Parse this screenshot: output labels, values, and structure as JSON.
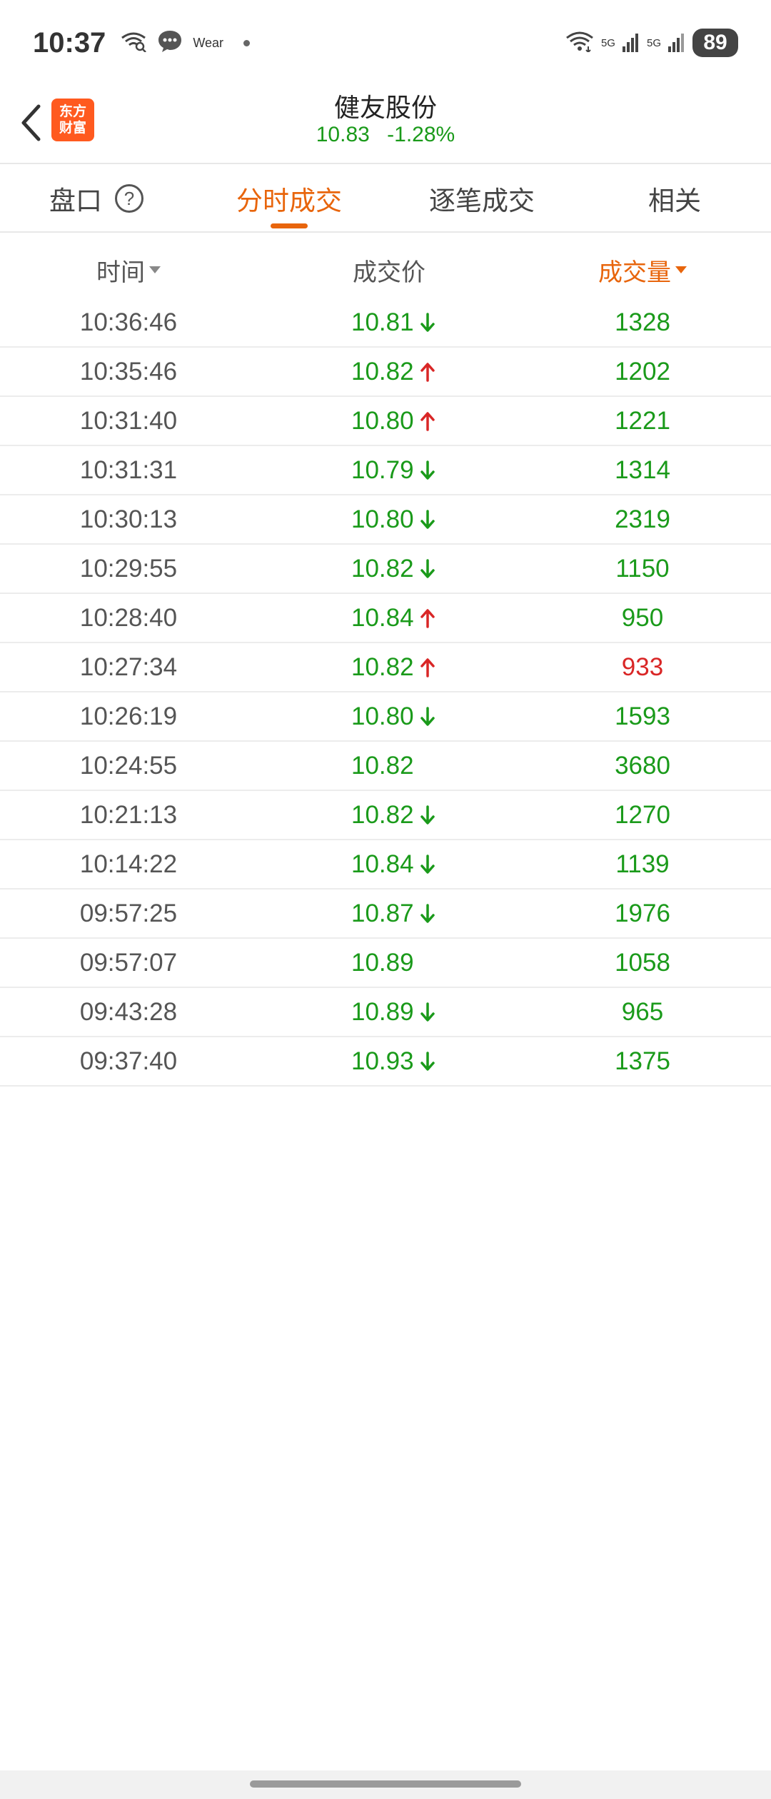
{
  "status_bar": {
    "time": "10:37",
    "wear": "Wear",
    "net1": "5G",
    "net2": "5G",
    "battery": "89"
  },
  "header": {
    "brand_line1": "东方",
    "brand_line2": "财富",
    "stock_name": "健友股份",
    "price": "10.83",
    "change_pct": "-1.28%"
  },
  "tabs": [
    {
      "label": "盘口"
    },
    {
      "label": "分时成交"
    },
    {
      "label": "逐笔成交"
    },
    {
      "label": "相关"
    }
  ],
  "table": {
    "col_time": "时间",
    "col_price": "成交价",
    "col_volume": "成交量",
    "rows": [
      {
        "time": "10:36:46",
        "price": "10.81",
        "dir": "down",
        "volume": "1328",
        "vol_color": "green"
      },
      {
        "time": "10:35:46",
        "price": "10.82",
        "dir": "up",
        "volume": "1202",
        "vol_color": "green"
      },
      {
        "time": "10:31:40",
        "price": "10.80",
        "dir": "up",
        "volume": "1221",
        "vol_color": "green"
      },
      {
        "time": "10:31:31",
        "price": "10.79",
        "dir": "down",
        "volume": "1314",
        "vol_color": "green"
      },
      {
        "time": "10:30:13",
        "price": "10.80",
        "dir": "down",
        "volume": "2319",
        "vol_color": "green"
      },
      {
        "time": "10:29:55",
        "price": "10.82",
        "dir": "down",
        "volume": "1150",
        "vol_color": "green"
      },
      {
        "time": "10:28:40",
        "price": "10.84",
        "dir": "up",
        "volume": "950",
        "vol_color": "green"
      },
      {
        "time": "10:27:34",
        "price": "10.82",
        "dir": "up",
        "volume": "933",
        "vol_color": "red"
      },
      {
        "time": "10:26:19",
        "price": "10.80",
        "dir": "down",
        "volume": "1593",
        "vol_color": "green"
      },
      {
        "time": "10:24:55",
        "price": "10.82",
        "dir": "none",
        "volume": "3680",
        "vol_color": "green"
      },
      {
        "time": "10:21:13",
        "price": "10.82",
        "dir": "down",
        "volume": "1270",
        "vol_color": "green"
      },
      {
        "time": "10:14:22",
        "price": "10.84",
        "dir": "down",
        "volume": "1139",
        "vol_color": "green"
      },
      {
        "time": "09:57:25",
        "price": "10.87",
        "dir": "down",
        "volume": "1976",
        "vol_color": "green"
      },
      {
        "time": "09:57:07",
        "price": "10.89",
        "dir": "none",
        "volume": "1058",
        "vol_color": "green"
      },
      {
        "time": "09:43:28",
        "price": "10.89",
        "dir": "down",
        "volume": "965",
        "vol_color": "green"
      },
      {
        "time": "09:37:40",
        "price": "10.93",
        "dir": "down",
        "volume": "1375",
        "vol_color": "green"
      }
    ]
  },
  "colors": {
    "accent": "#e8650c",
    "up": "#d92626",
    "down": "#1a9a1a",
    "brand": "#ff5a1f"
  }
}
